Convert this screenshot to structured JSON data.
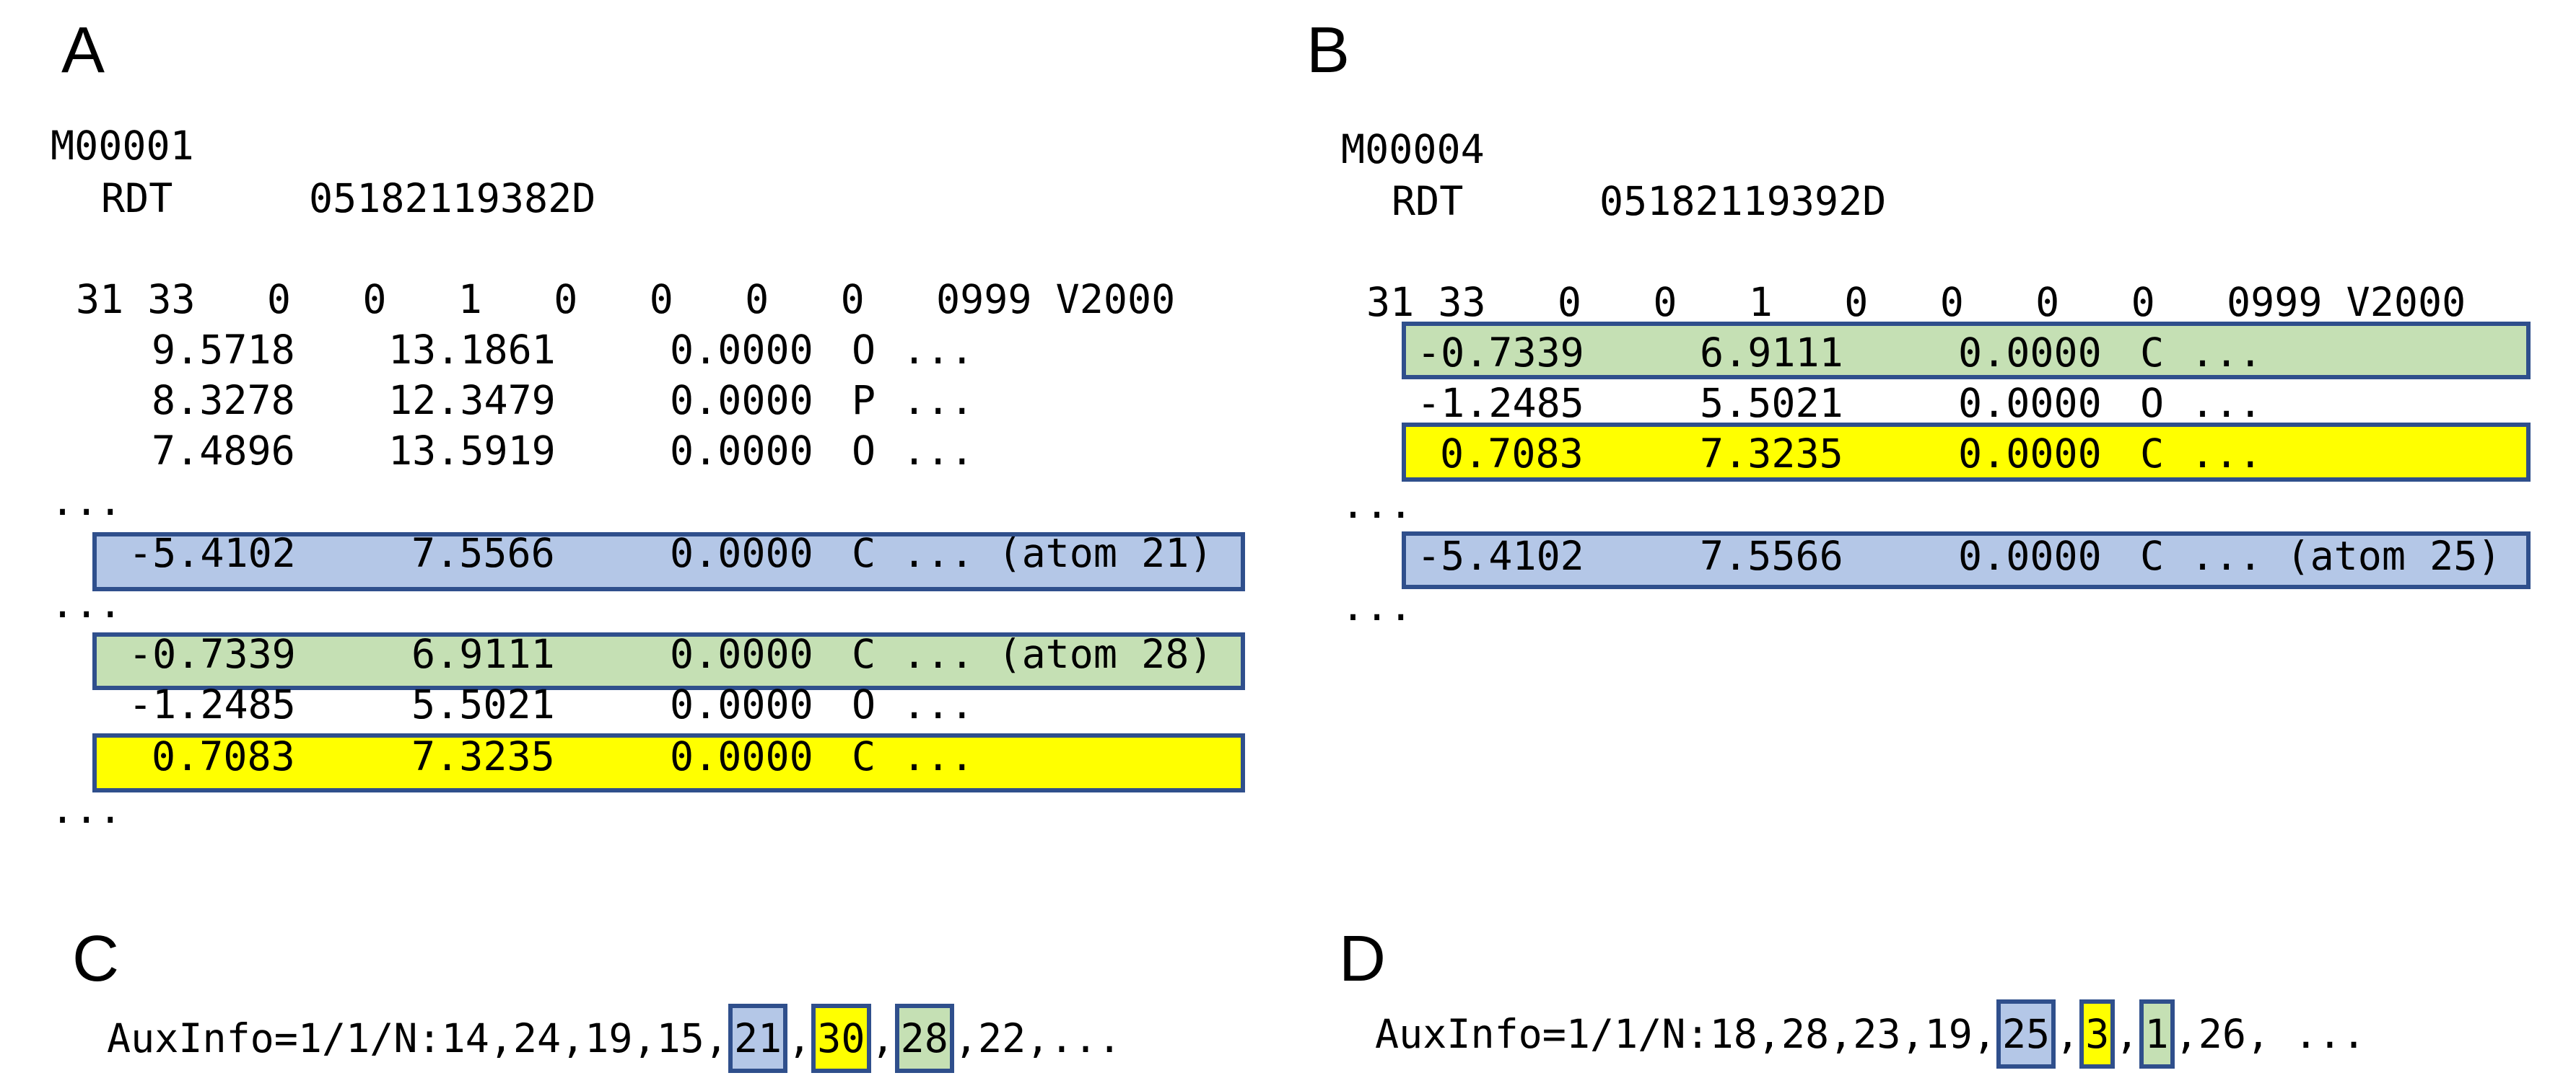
{
  "panelA": {
    "letter": "A",
    "molecule_id": "M00001",
    "rdt_label": "RDT",
    "rdt_value": "05182119382D",
    "counts_line": "31 33   0   0   1   0   0   0   0   0999 V2000",
    "rows": [
      {
        "x": "9.5718",
        "y": "13.1861",
        "z": "0.0000",
        "atom": "O",
        "rest": "..."
      },
      {
        "x": "8.3278",
        "y": "12.3479",
        "z": "0.0000",
        "atom": "P",
        "rest": "..."
      },
      {
        "x": "7.4896",
        "y": "13.5919",
        "z": "0.0000",
        "atom": "O",
        "rest": "..."
      },
      {
        "x": "-5.4102",
        "y": "7.5566",
        "z": "0.0000",
        "atom": "C",
        "rest": "... (atom 21)"
      },
      {
        "x": "-0.7339",
        "y": "6.9111",
        "z": "0.0000",
        "atom": "C",
        "rest": "... (atom 28)"
      },
      {
        "x": "-1.2485",
        "y": "5.5021",
        "z": "0.0000",
        "atom": "O",
        "rest": "..."
      },
      {
        "x": "0.7083",
        "y": "7.3235",
        "z": "0.0000",
        "atom": "C",
        "rest": "..."
      }
    ],
    "ellipses": [
      "...",
      "...",
      "..."
    ]
  },
  "panelB": {
    "letter": "B",
    "molecule_id": "M00004",
    "rdt_label": "RDT",
    "rdt_value": "05182119392D",
    "counts_line": "31 33   0   0   1   0   0   0   0   0999 V2000",
    "rows": [
      {
        "x": "-0.7339",
        "y": "6.9111",
        "z": "0.0000",
        "atom": "C",
        "rest": "..."
      },
      {
        "x": "-1.2485",
        "y": "5.5021",
        "z": "0.0000",
        "atom": "O",
        "rest": "..."
      },
      {
        "x": "0.7083",
        "y": "7.3235",
        "z": "0.0000",
        "atom": "C",
        "rest": "..."
      },
      {
        "x": "-5.4102",
        "y": "7.5566",
        "z": "0.0000",
        "atom": "C",
        "rest": "... (atom 25)"
      }
    ],
    "ellipses": [
      "...",
      "..."
    ]
  },
  "panelC": {
    "letter": "C",
    "prefix": "AuxInfo=1/1/N:14,24,19,15,",
    "box1": "21",
    "sep1": ",",
    "box2": "30",
    "sep2": ",",
    "box3": "28",
    "suffix": ",22,..."
  },
  "panelD": {
    "letter": "D",
    "prefix": "AuxInfo=1/1/N:18,28,23,19,",
    "box1": "25",
    "sep1": ",",
    "box2": "3",
    "sep2": ",",
    "box3": "1",
    "suffix": ",26, ..."
  },
  "colors": {
    "blue": "#b4c7e7",
    "green": "#c5e0b4",
    "yellow": "#ffff00",
    "border": "#2f4f8c"
  }
}
